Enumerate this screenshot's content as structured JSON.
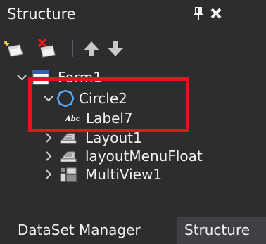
{
  "panel": {
    "title": "Structure",
    "pin_icon": "pin-icon",
    "close_icon": "close-icon"
  },
  "toolbar": {
    "buttons": [
      {
        "icon": "add-item-icon"
      },
      {
        "icon": "delete-item-icon"
      },
      {
        "icon": "move-up-icon"
      },
      {
        "icon": "move-down-icon"
      }
    ]
  },
  "tree": {
    "nodes": [
      {
        "label": "Form1",
        "icon": "form-icon",
        "expanded": true
      },
      {
        "label": "Circle2",
        "icon": "circle-icon",
        "expanded": true
      },
      {
        "label": "Label7",
        "icon": "label-icon"
      },
      {
        "label": "Layout1",
        "icon": "layout-icon",
        "expanded": false
      },
      {
        "label": "layoutMenuFloat",
        "icon": "layout-icon",
        "expanded": false
      },
      {
        "label": "MultiView1",
        "icon": "multiview-icon",
        "expanded": false
      }
    ]
  },
  "tabs": [
    {
      "label": "DataSet Manager",
      "active": false
    },
    {
      "label": "Structure",
      "active": true
    }
  ],
  "colors": {
    "background": "#2d2d30",
    "text": "#f1f1f1",
    "highlight_border": "#e8141b",
    "active_tab": "#3f3f46",
    "arrow_icon": "#c8c8c8"
  }
}
